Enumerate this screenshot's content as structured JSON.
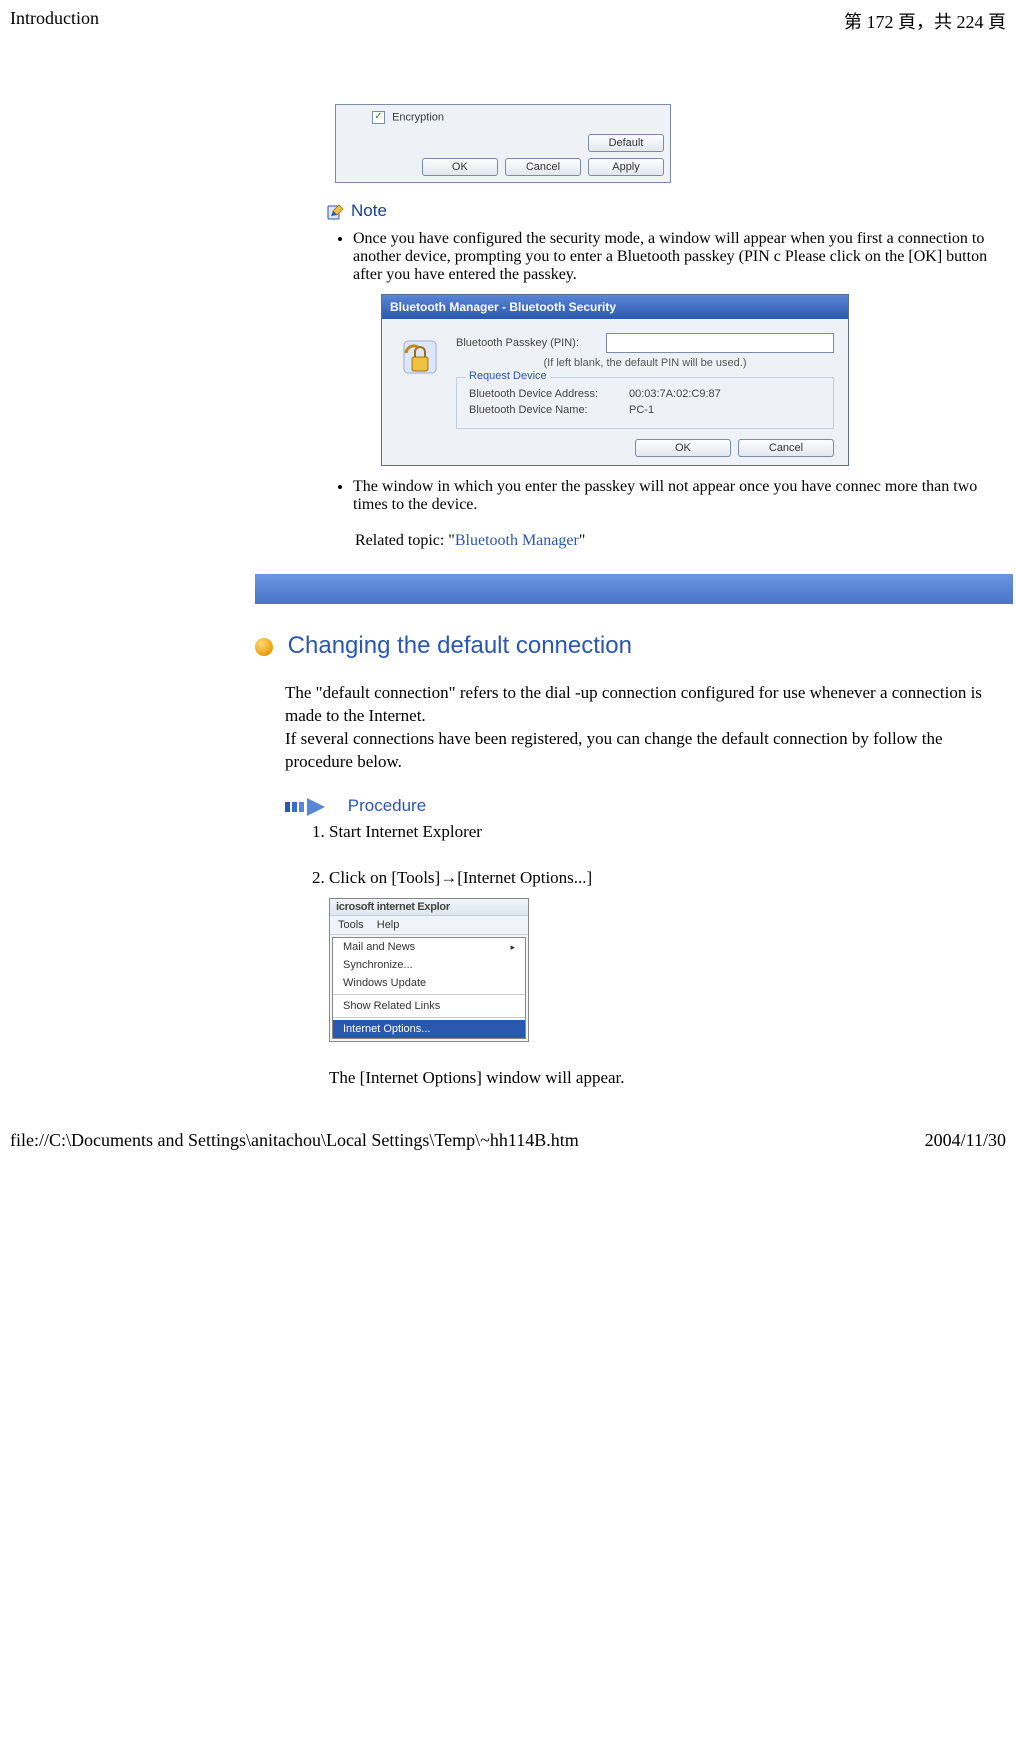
{
  "header": {
    "title": "Introduction",
    "page_info": "第 172 頁，共 224 頁"
  },
  "dialog1": {
    "checkbox_label": "Encryption",
    "btn_default": "Default",
    "btn_ok": "OK",
    "btn_cancel": "Cancel",
    "btn_apply": "Apply"
  },
  "note": {
    "label": "Note",
    "items": [
      "Once you have configured the security mode, a window will appear when you first a connection to another device, prompting you to enter a Bluetooth passkey (PIN c Please click on the [OK] button after you have entered the passkey.",
      "The window in which you enter the passkey will not appear once you have connec more than two times to the device."
    ]
  },
  "dialog2": {
    "title": "Bluetooth Manager - Bluetooth Security",
    "pin_label": "Bluetooth Passkey (PIN):",
    "hint": "(If left blank, the default PIN will be used.)",
    "group_title": "Request Device",
    "rows": [
      {
        "k": "Bluetooth Device Address:",
        "v": "00:03:7A:02:C9:87"
      },
      {
        "k": "Bluetooth Device Name:",
        "v": "PC-1"
      }
    ],
    "btn_ok": "OK",
    "btn_cancel": "Cancel"
  },
  "related": {
    "prefix": "Related topic: \"",
    "link": "Bluetooth Manager",
    "suffix": "\""
  },
  "section": {
    "title": "Changing the default connection",
    "body1": "The \"default connection\" refers to the dial -up connection configured for use whenever a connection is made to the Internet.",
    "body2": "If several connections have been registered, you can change the default connection by follow the procedure below."
  },
  "procedure": {
    "label": "Procedure",
    "steps": [
      "Start Internet Explorer",
      "Click on [Tools]→[Internet Options...]"
    ],
    "menu": {
      "toolbar": "icrosoft internet Explor",
      "menubar": [
        "Tools",
        "Help"
      ],
      "items": [
        "Mail and News",
        "Synchronize...",
        "Windows Update",
        "—",
        "Show Related Links",
        "—",
        "Internet Options..."
      ]
    },
    "after_menu": "The [Internet Options] window will appear."
  },
  "footer": {
    "path": "file://C:\\Documents and Settings\\anitachou\\Local Settings\\Temp\\~hh114B.htm",
    "date": "2004/11/30"
  }
}
